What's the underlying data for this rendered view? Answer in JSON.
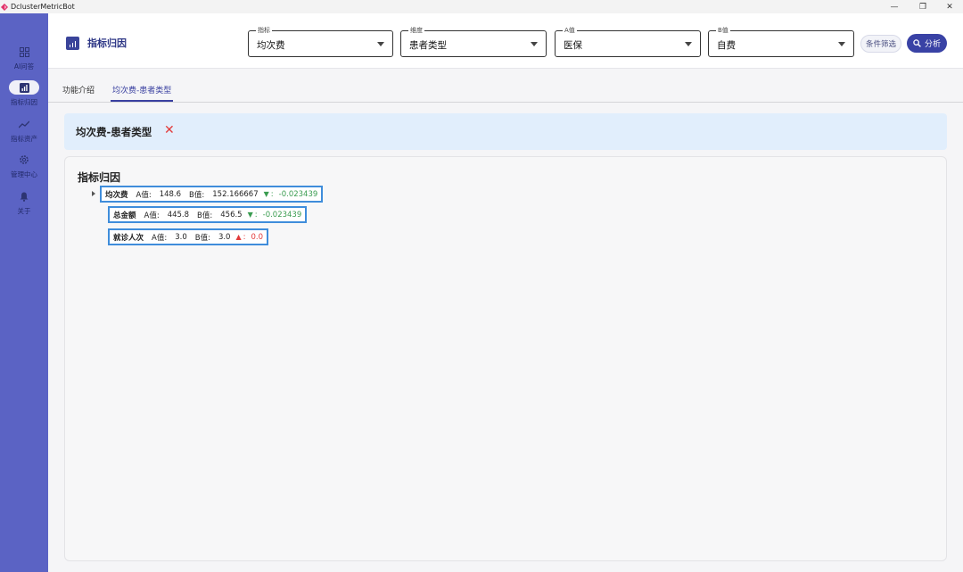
{
  "window": {
    "title": "DclusterMetricBot",
    "brand_color": "#e0336a",
    "minimize": "—",
    "restore": "❐",
    "close": "✕"
  },
  "sidebar": {
    "bg_color": "#5b63c4",
    "items": [
      {
        "label": "AI问答",
        "icon": "grid-icon",
        "glyph": "▦"
      },
      {
        "label": "指标归因",
        "icon": "bar-chart-icon",
        "glyph": "▮",
        "active": true
      },
      {
        "label": "指标资产",
        "icon": "trend-line-icon",
        "glyph": "↗"
      },
      {
        "label": "管理中心",
        "icon": "gear-icon",
        "glyph": "⚙"
      },
      {
        "label": "关于",
        "icon": "bell-icon",
        "glyph": "🔔"
      }
    ]
  },
  "header": {
    "title": "指标归因",
    "fields": [
      {
        "label": "指标",
        "value": "均次费"
      },
      {
        "label": "维度",
        "value": "患者类型"
      },
      {
        "label": "A值",
        "value": "医保"
      },
      {
        "label": "B值",
        "value": "自费"
      }
    ],
    "filter_button": "条件筛选",
    "analyze_button": "分析",
    "accent_color": "#3942a5"
  },
  "tabs": [
    {
      "label": "功能介绍"
    },
    {
      "label": "均次费-患者类型",
      "active": true
    }
  ],
  "banner": {
    "title": "均次费-患者类型",
    "close_glyph": "✕"
  },
  "panel": {
    "title": "指标归因",
    "nodes": [
      {
        "name": "均次费",
        "a_label": "A值:",
        "a_value": "148.6",
        "b_label": "B值:",
        "b_value": "152.166667",
        "arrow": "▼",
        "colon": ":",
        "diff": "-0.023439"
      },
      {
        "name": "总金额",
        "a_label": "A值:",
        "a_value": "445.8",
        "b_label": "B值:",
        "b_value": "456.5",
        "arrow": "▼",
        "colon": ":",
        "diff": "-0.023439"
      },
      {
        "name": "就诊人次",
        "a_label": "A值:",
        "a_value": "3.0",
        "b_label": "B值:",
        "b_value": "3.0",
        "arrow": "▲",
        "colon": ":",
        "diff": "0.0"
      }
    ],
    "down_color": "#3a9c50",
    "up_color": "#e23b3b"
  }
}
